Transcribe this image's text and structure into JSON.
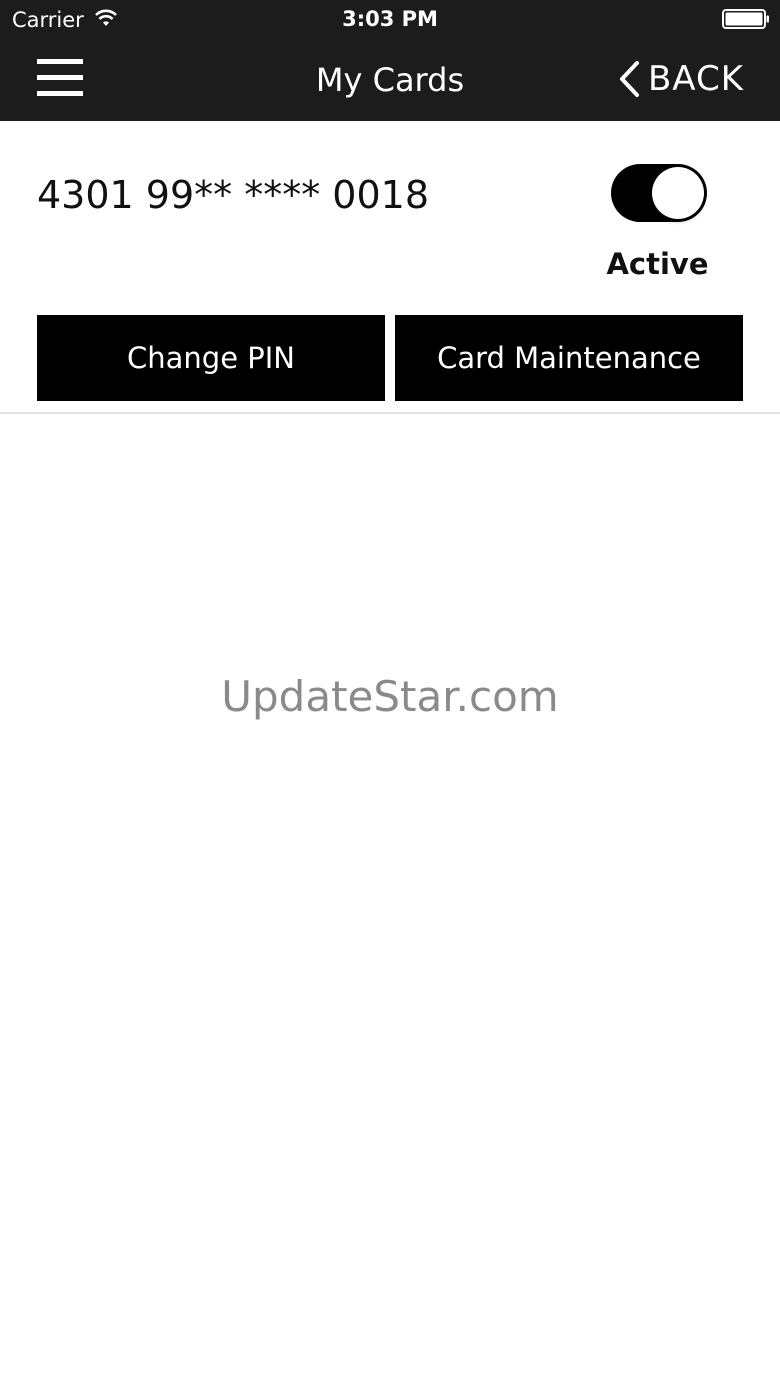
{
  "status_bar": {
    "carrier": "Carrier",
    "time": "3:03 PM"
  },
  "nav": {
    "title": "My Cards",
    "back_label": "BACK"
  },
  "card": {
    "number": "4301 99** **** 0018",
    "active": true,
    "status_label": "Active"
  },
  "actions": {
    "change_pin": "Change PIN",
    "card_maintenance": "Card Maintenance"
  },
  "watermark": "UpdateStar.com",
  "colors": {
    "nav_background": "#1c1c1c",
    "button_background": "#000000",
    "toggle_on": "#000000"
  }
}
